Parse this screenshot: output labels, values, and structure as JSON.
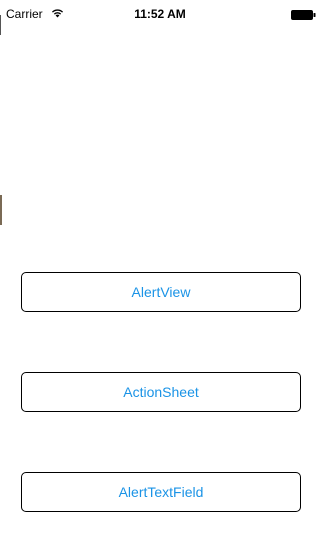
{
  "status_bar": {
    "carrier": "Carrier",
    "time": "11:52 AM",
    "wifi_icon": "wifi-icon",
    "battery_icon": "battery-icon"
  },
  "buttons": {
    "alert_view": "AlertView",
    "action_sheet": "ActionSheet",
    "alert_text_field": "AlertTextField"
  },
  "colors": {
    "accent": "#1a93e6",
    "border": "#000000",
    "background": "#ffffff"
  }
}
